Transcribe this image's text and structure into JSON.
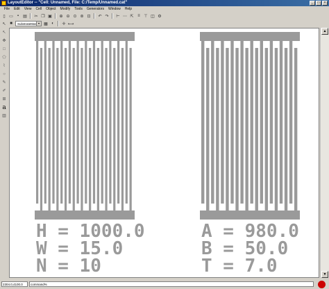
{
  "window": {
    "title": "LayoutEditor -- \"Cell: Unnamed, File: C:/Temp/Unnamed.cat\""
  },
  "menu": [
    "File",
    "Edit",
    "View",
    "Cell",
    "Object",
    "Modify",
    "Tools",
    "Generators",
    "Window",
    "Help"
  ],
  "toolbar": {
    "layer": "SubstrateMask"
  },
  "labels": {
    "left": [
      "H = 1000.0",
      "W = 15.0",
      "N = 10"
    ],
    "right": [
      "A = 980.0",
      "B = 50.0",
      "T = 7.0"
    ]
  },
  "status": {
    "coords": "2304.0,4100.0",
    "command": "command%"
  }
}
